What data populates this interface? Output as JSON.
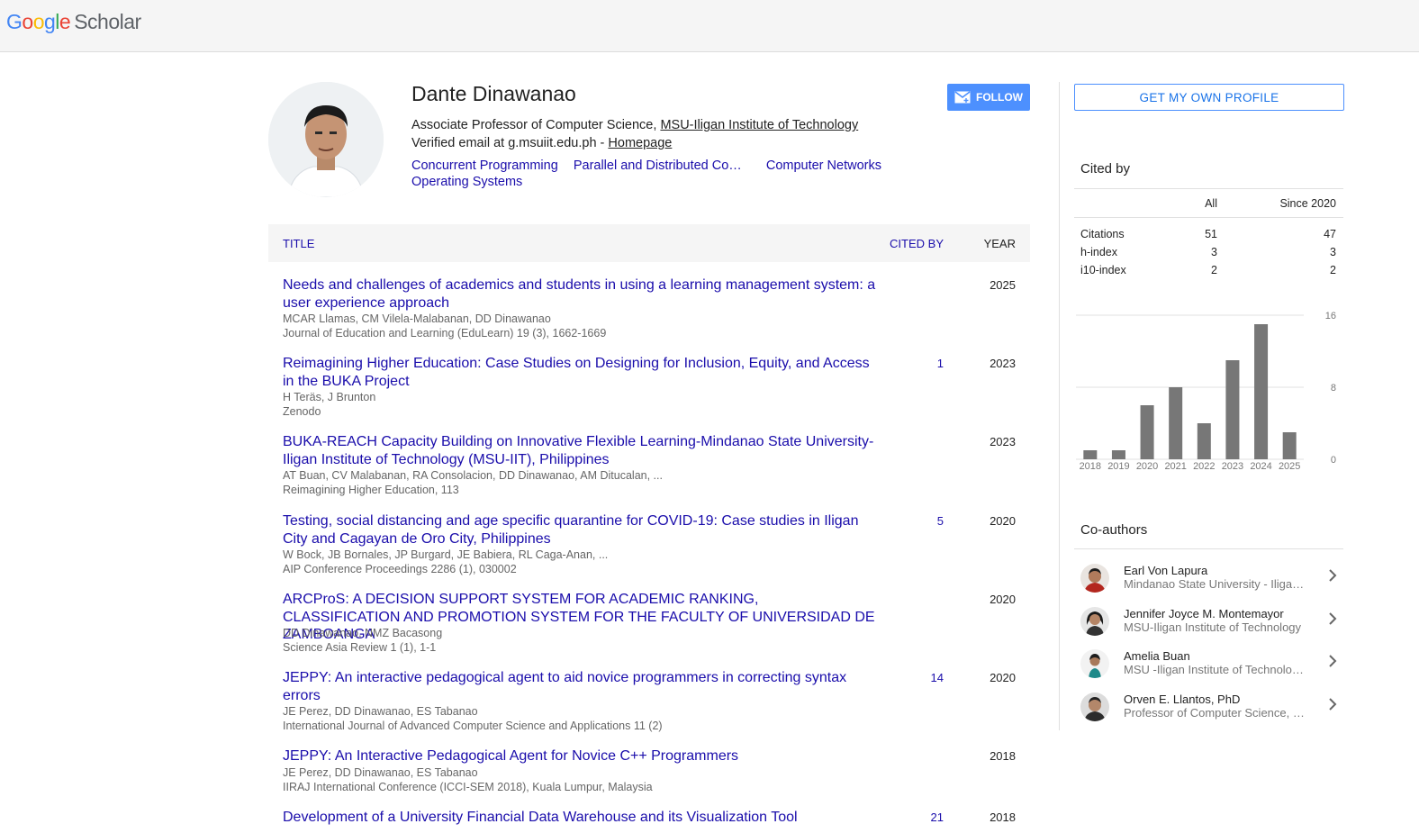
{
  "header": {
    "logo_google": "Google",
    "logo_scholar": "Scholar"
  },
  "profile": {
    "name": "Dante Dinawanao",
    "affiliation_prefix": "Associate Professor of Computer Science, ",
    "affiliation_link": "MSU-Iligan Institute of Technology",
    "email_prefix": "Verified email at g.msuiit.edu.ph - ",
    "homepage_link": "Homepage",
    "interests": [
      "Concurrent Programming",
      "Parallel and Distributed Co…",
      "Computer Networks",
      "Operating Systems"
    ],
    "follow_label": "FOLLOW",
    "get_profile_label": "GET MY OWN PROFILE"
  },
  "table": {
    "col_title": "TITLE",
    "col_cited": "CITED BY",
    "col_year": "YEAR",
    "articles": [
      {
        "title": "Needs and challenges of academics and students in using a learning management system: a user experience approach",
        "authors": "MCAR Llamas, CM Vilela-Malabanan, DD Dinawanao",
        "venue": "Journal of Education and Learning (EduLearn) 19 (3), 1662-1669",
        "cited": "",
        "year": "2025"
      },
      {
        "title": "Reimagining Higher Education: Case Studies on Designing for Inclusion, Equity, and Access in the BUKA Project",
        "authors": "H Teräs, J Brunton",
        "venue": "Zenodo",
        "cited": "1",
        "year": "2023"
      },
      {
        "title": "BUKA-REACH Capacity Building on Innovative Flexible Learning-Mindanao State University-Iligan Institute of Technology (MSU-IIT), Philippines",
        "authors": "AT Buan, CV Malabanan, RA Consolacion, DD Dinawanao, AM Ditucalan, ...",
        "venue": "Reimagining Higher Education, 113",
        "cited": "",
        "year": "2023"
      },
      {
        "title": "Testing, social distancing and age specific quarantine for COVID-19: Case studies in Iligan City and Cagayan de Oro City, Philippines",
        "authors": "W Bock, JB Bornales, JP Burgard, JE Babiera, RL Caga-Anan, ...",
        "venue": "AIP Conference Proceedings 2286 (1), 030002",
        "cited": "5",
        "year": "2020"
      },
      {
        "title": "ARCProS: A DECISION SUPPORT SYSTEM FOR ACADEMIC RANKING, CLASSIFICATION AND PROMOTION SYSTEM FOR THE FACULTY OF UNIVERSIDAD DE ZAMBOANGA",
        "authors": "DD Dinawanao, NMZ Bacasong",
        "venue": "Science Asia Review 1 (1), 1-1",
        "cited": "",
        "year": "2020"
      },
      {
        "title": "JEPPY: An interactive pedagogical agent to aid novice programmers in correcting syntax errors",
        "authors": "JE Perez, DD Dinawanao, ES Tabanao",
        "venue": "International Journal of Advanced Computer Science and Applications 11 (2)",
        "cited": "14",
        "year": "2020"
      },
      {
        "title": "JEPPY: An Interactive Pedagogical Agent for Novice C++ Programmers",
        "authors": "JE Perez, DD Dinawanao, ES Tabanao",
        "venue": "IIRAJ International Conference (ICCI-SEM 2018), Kuala Lumpur, Malaysia",
        "cited": "",
        "year": "2018"
      },
      {
        "title": "Development of a University Financial Data Warehouse and its Visualization Tool",
        "authors": "",
        "venue": "",
        "cited": "21",
        "year": "2018"
      }
    ]
  },
  "cited_by": {
    "heading": "Cited by",
    "col_all": "All",
    "col_since": "Since 2020",
    "rows": [
      {
        "label": "Citations",
        "all": "51",
        "since": "47"
      },
      {
        "label": "h-index",
        "all": "3",
        "since": "3"
      },
      {
        "label": "i10-index",
        "all": "2",
        "since": "2"
      }
    ]
  },
  "chart_data": {
    "type": "bar",
    "categories": [
      "2018",
      "2019",
      "2020",
      "2021",
      "2022",
      "2023",
      "2024",
      "2025"
    ],
    "values": [
      1,
      1,
      6,
      8,
      4,
      11,
      15,
      3
    ],
    "ylim": [
      0,
      16
    ],
    "yticks": [
      "0",
      "8",
      "16"
    ],
    "grid": true,
    "bar_color": "#777777"
  },
  "coauthors": {
    "heading": "Co-authors",
    "items": [
      {
        "name": "Earl Von Lapura",
        "affiliation": "Mindanao State University - Iliga…"
      },
      {
        "name": "Jennifer Joyce M. Montemayor",
        "affiliation": "MSU-Iligan Institute of Technology"
      },
      {
        "name": "Amelia Buan",
        "affiliation": "MSU -Iligan Institute of Technolo…"
      },
      {
        "name": "Orven E. Llantos, PhD",
        "affiliation": "Professor of Computer Science, …"
      }
    ]
  }
}
